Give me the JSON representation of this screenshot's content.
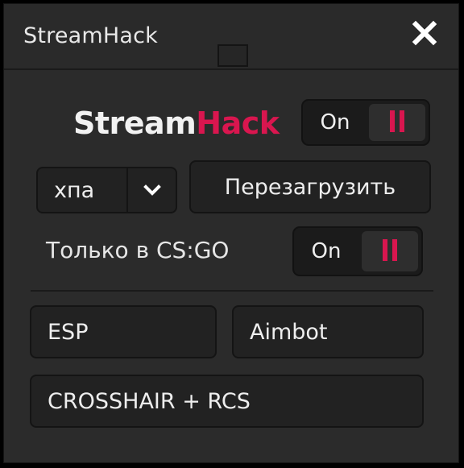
{
  "window": {
    "title": "StreamHack",
    "close_glyph": "X"
  },
  "brand": {
    "part1": "Stream",
    "part2": "Hack",
    "accent_color": "#d9164f"
  },
  "main_toggle": {
    "label": "On",
    "state": "on",
    "knob_icon": "pause-icon"
  },
  "profile": {
    "selected": "хпа",
    "chevron_icon": "chevron-down-icon"
  },
  "reload_button": {
    "label": "Перезагрузить"
  },
  "csgo_only": {
    "label": "Только в CS:GO",
    "toggle_label": "On",
    "state": "on",
    "knob_icon": "pause-icon"
  },
  "features": {
    "esp": "ESP",
    "aimbot": "Aimbot",
    "crosshair_rcs": "CROSSHAIR + RCS"
  }
}
